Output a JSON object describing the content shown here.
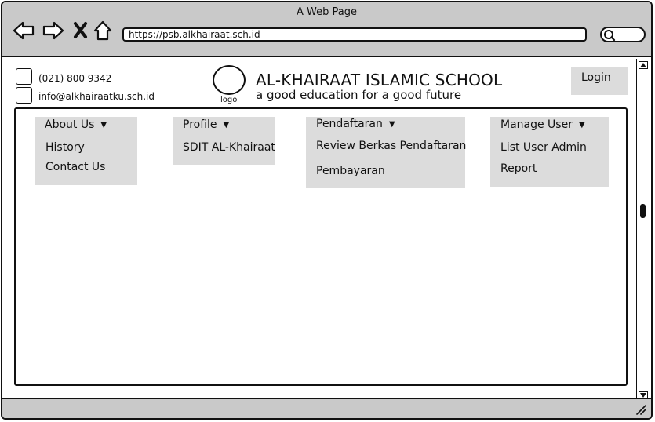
{
  "window": {
    "title": "A Web Page",
    "url": "https://psb.alkhairaat.sch.id"
  },
  "icons": [
    "back-icon",
    "forward-icon",
    "close-icon",
    "home-icon",
    "search-icon",
    "resize-grip-icon"
  ],
  "contact": {
    "phone": "(021) 800 9342",
    "email": "info@alkhairaatku.sch.id"
  },
  "brand": {
    "logo_label": "logo",
    "name": "AL-KHAIRAAT ISLAMIC SCHOOL",
    "tagline": "a good education for a good future"
  },
  "login_label": "Login",
  "menus": [
    {
      "label": "About Us",
      "items": [
        "History",
        "Contact Us"
      ]
    },
    {
      "label": "Profile",
      "items": [
        "SDIT AL-Khairaat"
      ]
    },
    {
      "label": "Pendaftaran",
      "items": [
        "Review Berkas Pendaftaran",
        "Pembayaran"
      ]
    },
    {
      "label": "Manage User",
      "items": [
        "List User Admin",
        "Report"
      ]
    }
  ],
  "colors": {
    "chrome": "#c9c9c9",
    "menu_bg": "#dcdcdc",
    "ink": "#111111"
  }
}
